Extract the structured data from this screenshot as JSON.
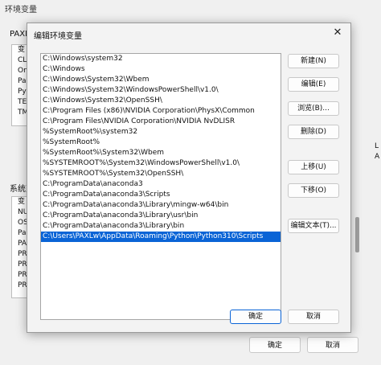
{
  "background": {
    "title": "环境变量",
    "user_vars_label": "PAXL",
    "user_list": [
      "变",
      "CLi",
      "On",
      "Pa",
      "Py",
      "TE",
      "TM"
    ],
    "sys_vars_label": "系统变",
    "sys_list": [
      "变",
      "NU",
      "OS",
      "Pa",
      "PA",
      "PR",
      "PR",
      "PR",
      "PR"
    ],
    "right_chars": [
      "L",
      "A"
    ],
    "ok_label": "确定",
    "cancel_label": "取消"
  },
  "dialog": {
    "title": "编辑环境变量",
    "close_glyph": "✕",
    "paths": [
      "C:\\Windows\\system32",
      "C:\\Windows",
      "C:\\Windows\\System32\\Wbem",
      "C:\\Windows\\System32\\WindowsPowerShell\\v1.0\\",
      "C:\\Windows\\System32\\OpenSSH\\",
      "C:\\Program Files (x86)\\NVIDIA Corporation\\PhysX\\Common",
      "C:\\Program Files\\NVIDIA Corporation\\NVIDIA NvDLISR",
      "%SystemRoot%\\system32",
      "%SystemRoot%",
      "%SystemRoot%\\System32\\Wbem",
      "%SYSTEMROOT%\\System32\\WindowsPowerShell\\v1.0\\",
      "%SYSTEMROOT%\\System32\\OpenSSH\\",
      "C:\\ProgramData\\anaconda3",
      "C:\\ProgramData\\anaconda3\\Scripts",
      "C:\\ProgramData\\anaconda3\\Library\\mingw-w64\\bin",
      "C:\\ProgramData\\anaconda3\\Library\\usr\\bin",
      "C:\\ProgramData\\anaconda3\\Library\\bin",
      "C:\\Users\\PAXLw\\AppData\\Roaming\\Python\\Python310\\Scripts"
    ],
    "selected_index": 17,
    "buttons": {
      "new": "新建(N)",
      "edit": "编辑(E)",
      "browse": "浏览(B)...",
      "delete": "删除(D)",
      "move_up": "上移(U)",
      "move_down": "下移(O)",
      "edit_text": "编辑文本(T)...",
      "ok": "确定",
      "cancel": "取消"
    },
    "accent_color": "#0a64d6"
  }
}
